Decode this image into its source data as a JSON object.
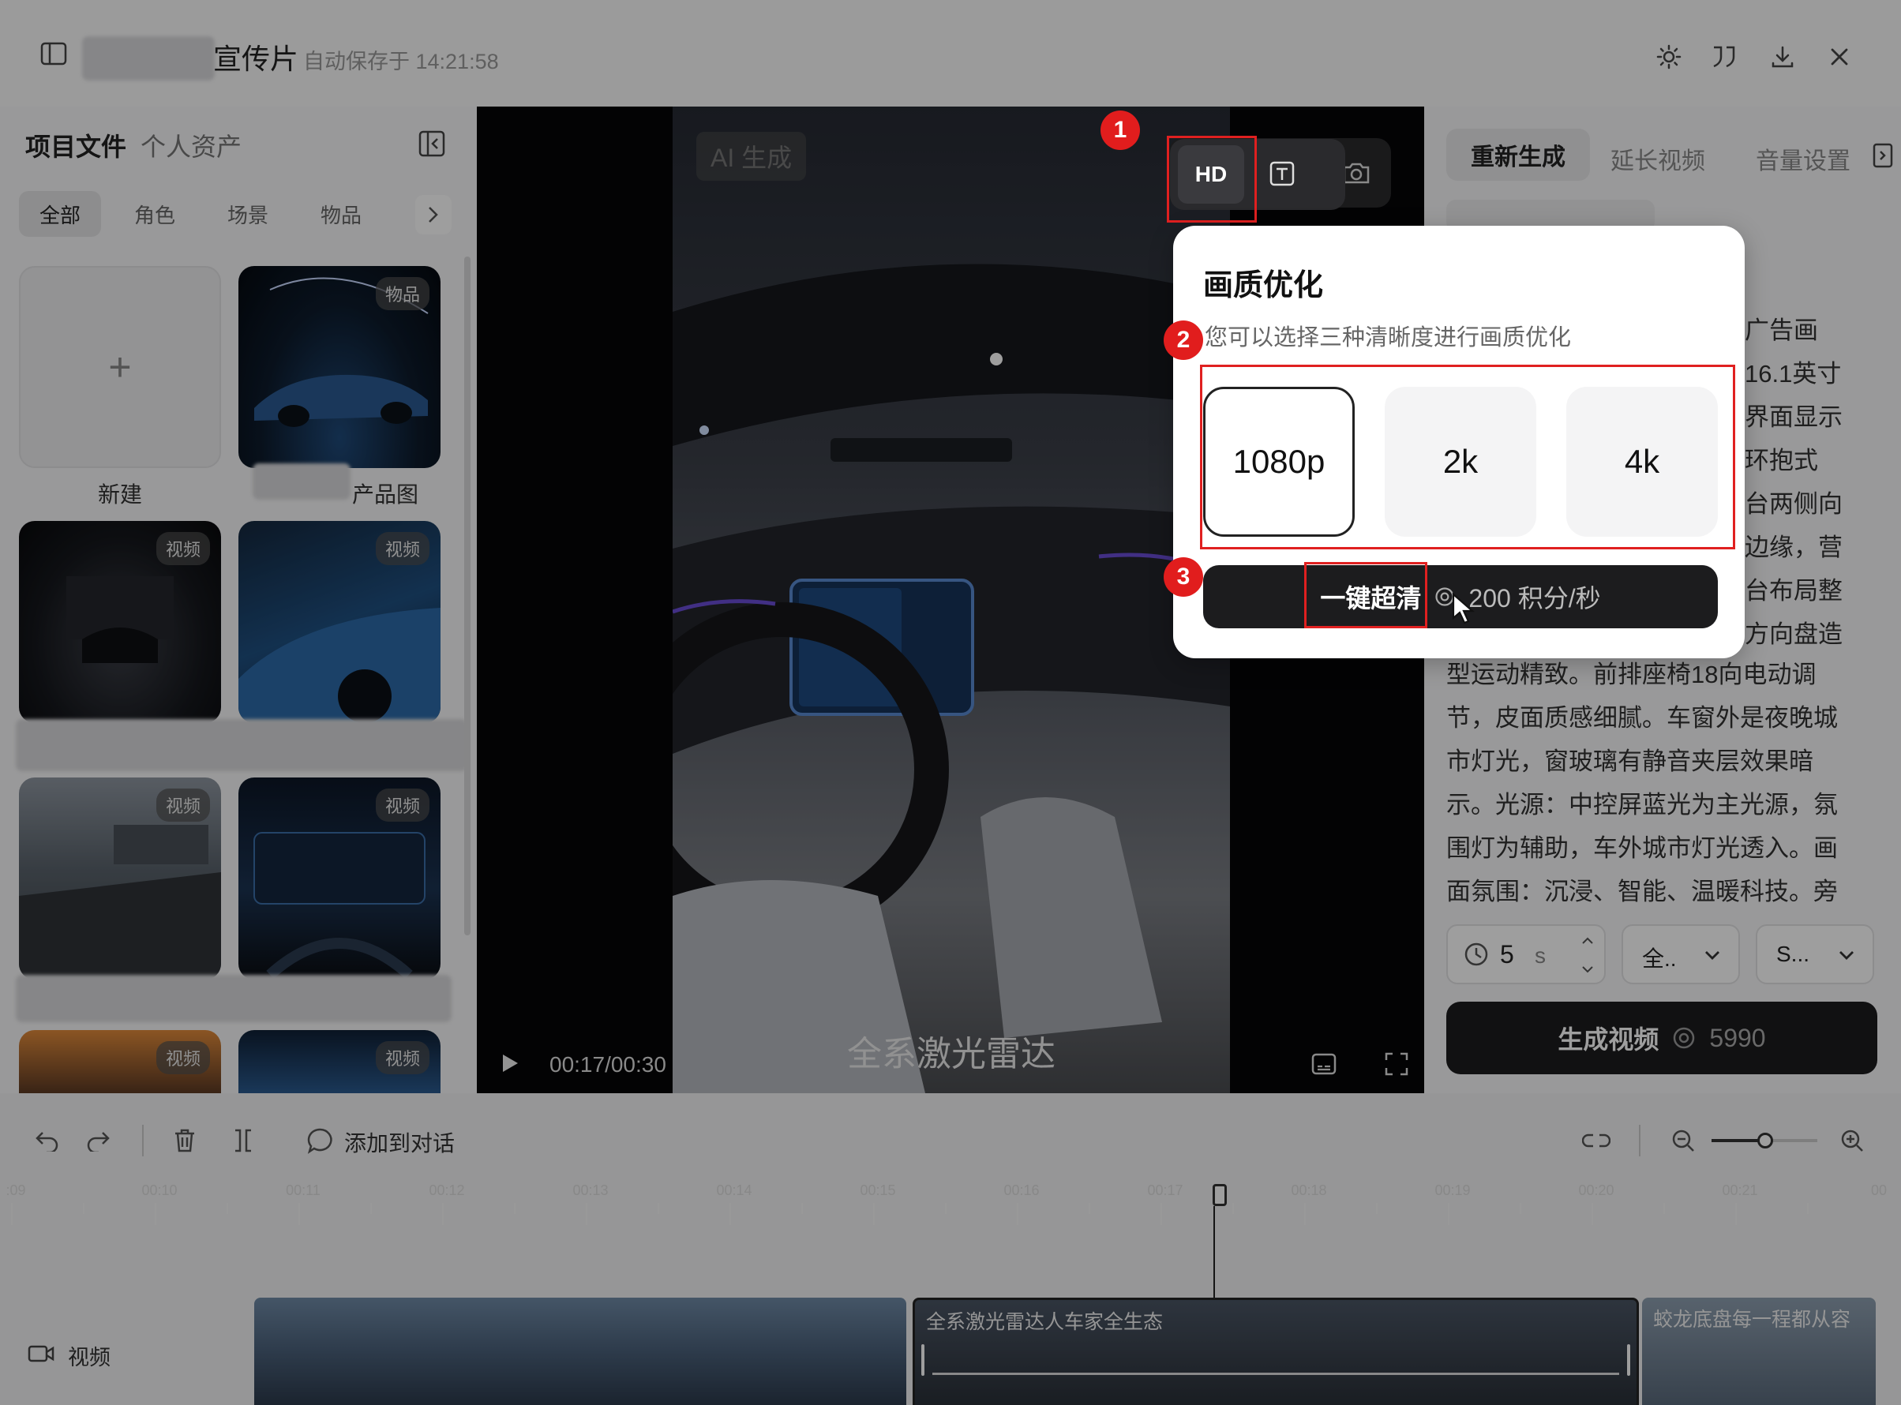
{
  "header": {
    "project_title": "宣传片",
    "autosave": "自动保存于 14:21:58"
  },
  "left_panel": {
    "tab_project": "项目文件",
    "tab_assets": "个人资产",
    "categories": [
      "全部",
      "角色",
      "场景",
      "物品"
    ],
    "new_label": "新建",
    "product_label": "产品图",
    "badges": {
      "item": "物品",
      "video": "视频"
    }
  },
  "preview": {
    "ai_tag": "AI 生成",
    "hd_label": "HD",
    "subtitle": "全系激光雷达",
    "time": "00:17/00:30"
  },
  "quality_popup": {
    "title": "画质优化",
    "subtitle": "您可以选择三种清晰度进行画质优化",
    "options": [
      "1080p",
      "2k",
      "4k"
    ],
    "selected": "1080p",
    "action_label": "一键超清",
    "cost_label": "200 积分/秒"
  },
  "markers": [
    "1",
    "2",
    "3"
  ],
  "right_panel": {
    "tabs": [
      "重新生成",
      "延长视频",
      "音量设置"
    ],
    "partial_lines": [
      "广告画",
      "16.1英寸",
      "界面显示",
      "环抱式",
      "台两侧向",
      "边缘，营",
      "台布局整",
      "方向盘造"
    ],
    "description_lines": [
      "型运动精致。前排座椅18向电动调",
      "节，皮面质感细腻。车窗外是夜晚城",
      "市灯光，窗玻璃有静音夹层效果暗",
      "示。光源：中控屏蓝光为主光源，氛",
      "围灯为辅助，车外城市灯光透入。画",
      "面氛围：沉浸、智能、温暖科技。旁"
    ],
    "duration_value": "5",
    "duration_unit": "s",
    "select_1": "全..",
    "select_2": "S...",
    "generate_label": "生成视频",
    "generate_cost": "5990"
  },
  "timeline": {
    "add_to_chat": "添加到对话",
    "ticks": [
      ":09",
      "00:10",
      "00:11",
      "00:12",
      "00:13",
      "00:14",
      "00:15",
      "00:16",
      "00:17",
      "00:18",
      "00:19",
      "00:20",
      "00:21",
      "00"
    ],
    "track_label": "视频",
    "clip_2_title": "全系激光雷达人车家全生态",
    "clip_3_title": "蛟龙底盘每一程都从容"
  },
  "colors": {
    "accent_dark": "#1c1c1e",
    "annotation_red": "#e02020",
    "panel_bg": "#f7f7f8"
  }
}
